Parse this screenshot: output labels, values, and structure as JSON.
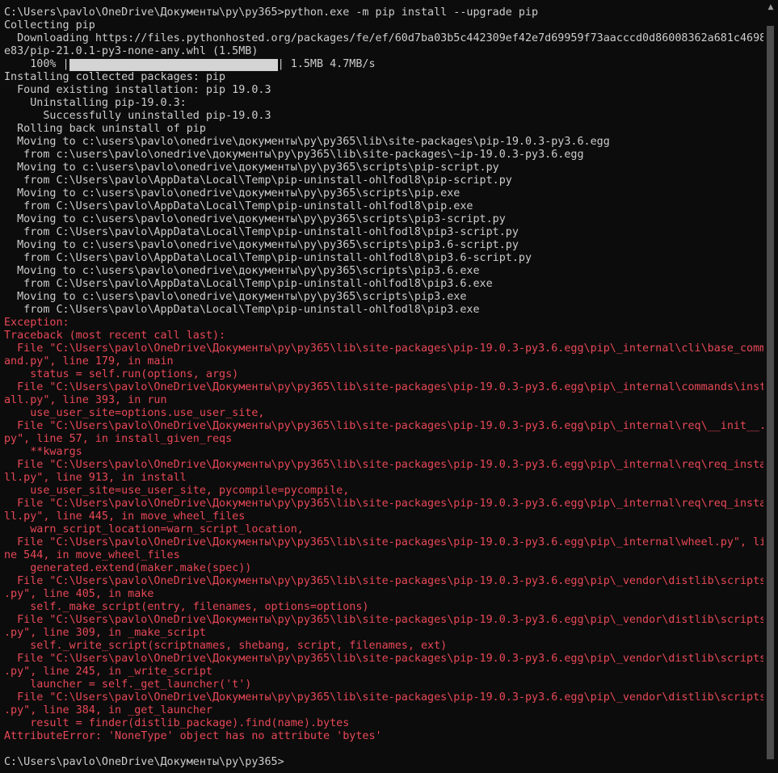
{
  "terminal": {
    "colors": {
      "background": "#0c0c0c",
      "text": "#cccccc",
      "error": "#e74856",
      "progress": "#d4d4d4"
    },
    "lines": [
      {
        "text": "C:\\Users\\pavlo\\OneDrive\\Документы\\py\\py365>python.exe -m pip install --upgrade pip",
        "style": "normal"
      },
      {
        "text": "Collecting pip",
        "style": "normal"
      },
      {
        "text": "  Downloading https://files.pythonhosted.org/packages/fe/ef/60d7ba03b5c442309ef42e7d69959f73aacccd0d86008362a681c4698",
        "style": "normal"
      },
      {
        "text": "e83/pip-21.0.1-py3-none-any.whl (1.5MB)",
        "style": "normal"
      },
      {
        "text": "    100% |",
        "style": "progress",
        "progress": 1.0,
        "suffix": "| 1.5MB 4.7MB/s"
      },
      {
        "text": "Installing collected packages: pip",
        "style": "normal"
      },
      {
        "text": "  Found existing installation: pip 19.0.3",
        "style": "normal"
      },
      {
        "text": "    Uninstalling pip-19.0.3:",
        "style": "normal"
      },
      {
        "text": "      Successfully uninstalled pip-19.0.3",
        "style": "normal"
      },
      {
        "text": "  Rolling back uninstall of pip",
        "style": "normal"
      },
      {
        "text": "  Moving to c:\\users\\pavlo\\onedrive\\документы\\py\\py365\\lib\\site-packages\\pip-19.0.3-py3.6.egg",
        "style": "normal"
      },
      {
        "text": "   from c:\\users\\pavlo\\onedrive\\документы\\py\\py365\\lib\\site-packages\\~ip-19.0.3-py3.6.egg",
        "style": "normal"
      },
      {
        "text": "  Moving to c:\\users\\pavlo\\onedrive\\документы\\py\\py365\\scripts\\pip-script.py",
        "style": "normal"
      },
      {
        "text": "   from C:\\Users\\pavlo\\AppData\\Local\\Temp\\pip-uninstall-ohlfodl8\\pip-script.py",
        "style": "normal"
      },
      {
        "text": "  Moving to c:\\users\\pavlo\\onedrive\\документы\\py\\py365\\scripts\\pip.exe",
        "style": "normal"
      },
      {
        "text": "   from C:\\Users\\pavlo\\AppData\\Local\\Temp\\pip-uninstall-ohlfodl8\\pip.exe",
        "style": "normal"
      },
      {
        "text": "  Moving to c:\\users\\pavlo\\onedrive\\документы\\py\\py365\\scripts\\pip3-script.py",
        "style": "normal"
      },
      {
        "text": "   from C:\\Users\\pavlo\\AppData\\Local\\Temp\\pip-uninstall-ohlfodl8\\pip3-script.py",
        "style": "normal"
      },
      {
        "text": "  Moving to c:\\users\\pavlo\\onedrive\\документы\\py\\py365\\scripts\\pip3.6-script.py",
        "style": "normal"
      },
      {
        "text": "   from C:\\Users\\pavlo\\AppData\\Local\\Temp\\pip-uninstall-ohlfodl8\\pip3.6-script.py",
        "style": "normal"
      },
      {
        "text": "  Moving to c:\\users\\pavlo\\onedrive\\документы\\py\\py365\\scripts\\pip3.6.exe",
        "style": "normal"
      },
      {
        "text": "   from C:\\Users\\pavlo\\AppData\\Local\\Temp\\pip-uninstall-ohlfodl8\\pip3.6.exe",
        "style": "normal"
      },
      {
        "text": "  Moving to c:\\users\\pavlo\\onedrive\\документы\\py\\py365\\scripts\\pip3.exe",
        "style": "normal"
      },
      {
        "text": "   from C:\\Users\\pavlo\\AppData\\Local\\Temp\\pip-uninstall-ohlfodl8\\pip3.exe",
        "style": "normal"
      },
      {
        "text": "Exception:",
        "style": "error"
      },
      {
        "text": "Traceback (most recent call last):",
        "style": "error"
      },
      {
        "text": "  File \"C:\\Users\\pavlo\\OneDrive\\Документы\\py\\py365\\lib\\site-packages\\pip-19.0.3-py3.6.egg\\pip\\_internal\\cli\\base_comm",
        "style": "error"
      },
      {
        "text": "and.py\", line 179, in main",
        "style": "error"
      },
      {
        "text": "    status = self.run(options, args)",
        "style": "error"
      },
      {
        "text": "  File \"C:\\Users\\pavlo\\OneDrive\\Документы\\py\\py365\\lib\\site-packages\\pip-19.0.3-py3.6.egg\\pip\\_internal\\commands\\inst",
        "style": "error"
      },
      {
        "text": "all.py\", line 393, in run",
        "style": "error"
      },
      {
        "text": "    use_user_site=options.use_user_site,",
        "style": "error"
      },
      {
        "text": "  File \"C:\\Users\\pavlo\\OneDrive\\Документы\\py\\py365\\lib\\site-packages\\pip-19.0.3-py3.6.egg\\pip\\_internal\\req\\__init__.",
        "style": "error"
      },
      {
        "text": "py\", line 57, in install_given_reqs",
        "style": "error"
      },
      {
        "text": "    **kwargs",
        "style": "error"
      },
      {
        "text": "  File \"C:\\Users\\pavlo\\OneDrive\\Документы\\py\\py365\\lib\\site-packages\\pip-19.0.3-py3.6.egg\\pip\\_internal\\req\\req_instal",
        "style": "error"
      },
      {
        "text": "ll.py\", line 913, in install",
        "style": "error"
      },
      {
        "text": "    use_user_site=use_user_site, pycompile=pycompile,",
        "style": "error"
      },
      {
        "text": "  File \"C:\\Users\\pavlo\\OneDrive\\Документы\\py\\py365\\lib\\site-packages\\pip-19.0.3-py3.6.egg\\pip\\_internal\\req\\req_instal",
        "style": "error"
      },
      {
        "text": "ll.py\", line 445, in move_wheel_files",
        "style": "error"
      },
      {
        "text": "    warn_script_location=warn_script_location,",
        "style": "error"
      },
      {
        "text": "  File \"C:\\Users\\pavlo\\OneDrive\\Документы\\py\\py365\\lib\\site-packages\\pip-19.0.3-py3.6.egg\\pip\\_internal\\wheel.py\", li",
        "style": "error"
      },
      {
        "text": "ne 544, in move_wheel_files",
        "style": "error"
      },
      {
        "text": "    generated.extend(maker.make(spec))",
        "style": "error"
      },
      {
        "text": "  File \"C:\\Users\\pavlo\\OneDrive\\Документы\\py\\py365\\lib\\site-packages\\pip-19.0.3-py3.6.egg\\pip\\_vendor\\distlib\\scripts",
        "style": "error"
      },
      {
        "text": ".py\", line 405, in make",
        "style": "error"
      },
      {
        "text": "    self._make_script(entry, filenames, options=options)",
        "style": "error"
      },
      {
        "text": "  File \"C:\\Users\\pavlo\\OneDrive\\Документы\\py\\py365\\lib\\site-packages\\pip-19.0.3-py3.6.egg\\pip\\_vendor\\distlib\\scripts",
        "style": "error"
      },
      {
        "text": ".py\", line 309, in _make_script",
        "style": "error"
      },
      {
        "text": "    self._write_script(scriptnames, shebang, script, filenames, ext)",
        "style": "error"
      },
      {
        "text": "  File \"C:\\Users\\pavlo\\OneDrive\\Документы\\py\\py365\\lib\\site-packages\\pip-19.0.3-py3.6.egg\\pip\\_vendor\\distlib\\scripts",
        "style": "error"
      },
      {
        "text": ".py\", line 245, in _write_script",
        "style": "error"
      },
      {
        "text": "    launcher = self._get_launcher('t')",
        "style": "error"
      },
      {
        "text": "  File \"C:\\Users\\pavlo\\OneDrive\\Документы\\py\\py365\\lib\\site-packages\\pip-19.0.3-py3.6.egg\\pip\\_vendor\\distlib\\scripts",
        "style": "error"
      },
      {
        "text": ".py\", line 384, in _get_launcher",
        "style": "error"
      },
      {
        "text": "    result = finder(distlib_package).find(name).bytes",
        "style": "error"
      },
      {
        "text": "AttributeError: 'NoneType' object has no attribute 'bytes'",
        "style": "error"
      },
      {
        "text": "",
        "style": "normal"
      },
      {
        "text": "C:\\Users\\pavlo\\OneDrive\\Документы\\py\\py365>",
        "style": "normal"
      }
    ]
  },
  "scrollbar": {
    "up_icon": "triangle-up-icon"
  }
}
